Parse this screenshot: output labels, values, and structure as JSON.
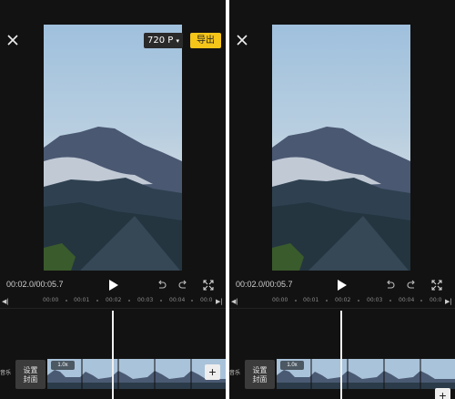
{
  "left": {
    "resolution_label": "720 P",
    "export_label": "导出",
    "time_display": "00:02.0/00:05.7",
    "ruler_ticks": [
      "00:00",
      "00:01",
      "00:02",
      "00:03",
      "00:04",
      "00:0"
    ],
    "cover_label_line1": "设置",
    "cover_label_line2": "封面",
    "speed_label": "1.0x",
    "side_label_top": "",
    "side_label_bottom": "音乐"
  },
  "right": {
    "time_display": "00:02.0/00:05.7",
    "ruler_ticks": [
      "00:00",
      "00:01",
      "00:02",
      "00:03",
      "00:04",
      "00:0"
    ],
    "cover_label_line1": "设置",
    "cover_label_line2": "封面",
    "speed_label": "1.0x",
    "side_label_bottom": "音乐"
  },
  "icons": {
    "close": "close-icon",
    "dropdown": "caret-down-icon",
    "play": "play-icon",
    "undo": "undo-icon",
    "redo": "redo-icon",
    "fullscreen": "fullscreen-icon",
    "skip_start": "skip-start-icon",
    "skip_end": "skip-end-icon",
    "add": "plus-icon"
  },
  "colors": {
    "background": "#121212",
    "export_button": "#f5c519",
    "divider": "#ffffff"
  }
}
